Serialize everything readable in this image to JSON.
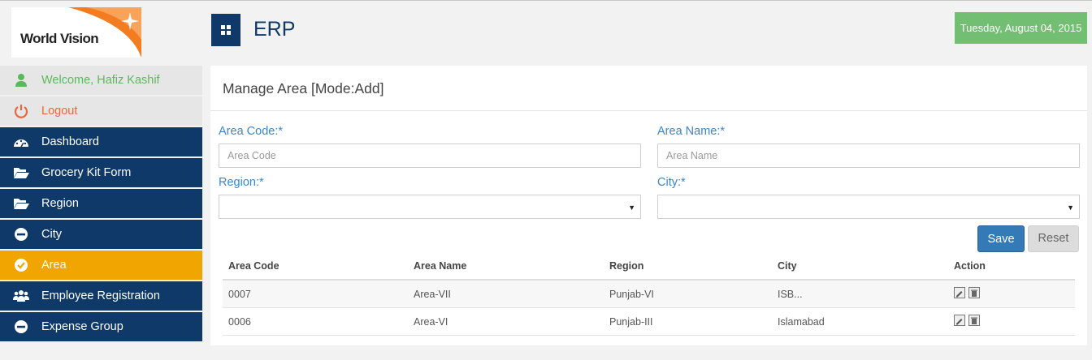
{
  "logo": {
    "text": "World Vision",
    "accent": "#f47c20"
  },
  "header": {
    "title": "ERP",
    "date": "Tuesday, August 04, 2015",
    "date_bg": "#72bf73",
    "brand": "#0e3968"
  },
  "sidebar": {
    "welcome": "Welcome, Hafiz Kashif",
    "logout": "Logout",
    "items": [
      {
        "label": "Dashboard",
        "icon": "dashboard-icon"
      },
      {
        "label": "Grocery Kit Form",
        "icon": "folder-open-icon"
      },
      {
        "label": "Region",
        "icon": "folder-open-icon"
      },
      {
        "label": "City",
        "icon": "minus-circle-icon"
      },
      {
        "label": "Area",
        "icon": "check-circle-icon",
        "active": true
      },
      {
        "label": "Employee Registration",
        "icon": "users-icon"
      },
      {
        "label": "Expense Group",
        "icon": "minus-circle-icon"
      }
    ],
    "active_color": "#f0a500"
  },
  "form": {
    "title": "Manage Area [Mode:Add]",
    "area_code_label": "Area Code:*",
    "area_code_placeholder": "Area Code",
    "area_name_label": "Area Name:*",
    "area_name_placeholder": "Area Name",
    "region_label": "Region:*",
    "region_value": "",
    "city_label": "City:*",
    "city_value": "",
    "save_label": "Save",
    "reset_label": "Reset"
  },
  "table": {
    "headers": [
      "Area Code",
      "Area Name",
      "Region",
      "City",
      "Action"
    ],
    "rows": [
      {
        "code": "0007",
        "name": "Area-VII",
        "region": "Punjab-VI",
        "city": "ISB..."
      },
      {
        "code": "0006",
        "name": "Area-VI",
        "region": "Punjab-III",
        "city": "Islamabad"
      }
    ]
  }
}
